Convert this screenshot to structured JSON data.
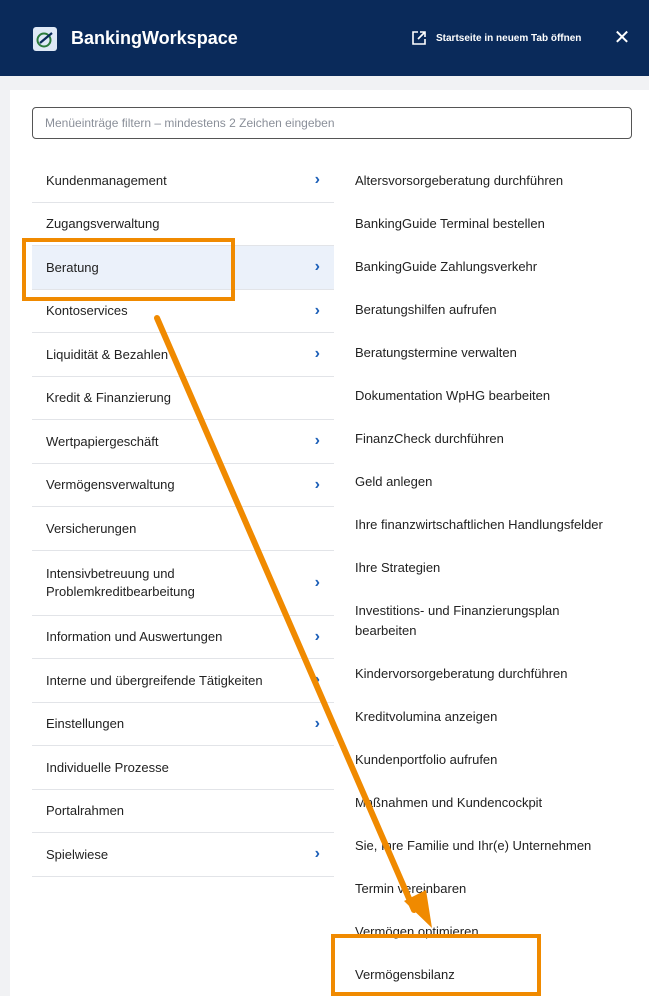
{
  "header": {
    "app_title": "BankingWorkspace",
    "open_tab_label": "Startseite in neuem Tab öffnen",
    "close_label": "✕",
    "colors": {
      "background": "#0a2a5a",
      "text": "#ffffff"
    }
  },
  "search": {
    "placeholder": "Menüeinträge filtern – mindestens 2 Zeichen eingeben",
    "value": ""
  },
  "left_menu": [
    {
      "label": "Kundenmanagement",
      "has_children": true
    },
    {
      "label": "Zugangsverwaltung",
      "has_children": false
    },
    {
      "label": "Beratung",
      "has_children": true,
      "selected": true
    },
    {
      "label": "Kontoservices",
      "has_children": true
    },
    {
      "label": "Liquidität & Bezahlen",
      "has_children": true
    },
    {
      "label": "Kredit & Finanzierung",
      "has_children": false
    },
    {
      "label": "Wertpapiergeschäft",
      "has_children": true
    },
    {
      "label": "Vermögensverwaltung",
      "has_children": true
    },
    {
      "label": "Versicherungen",
      "has_children": false
    },
    {
      "label": "Intensivbetreuung und Problemkreditbearbeitung",
      "has_children": true
    },
    {
      "label": "Information und Auswertungen",
      "has_children": true
    },
    {
      "label": "Interne und übergreifende Tätigkeiten",
      "has_children": true
    },
    {
      "label": "Einstellungen",
      "has_children": true
    },
    {
      "label": "Individuelle Prozesse",
      "has_children": false
    },
    {
      "label": "Portalrahmen",
      "has_children": false
    },
    {
      "label": "Spielwiese",
      "has_children": true
    }
  ],
  "right_menu": [
    "Altersvorsorgeberatung durchführen",
    "BankingGuide Terminal bestellen",
    "BankingGuide Zahlungsverkehr",
    "Beratungshilfen aufrufen",
    "Beratungstermine verwalten",
    "Dokumentation WpHG bearbeiten",
    "FinanzCheck durchführen",
    "Geld anlegen",
    "Ihre finanzwirtschaftlichen Handlungsfelder",
    "Ihre Strategien",
    "Investitions- und Finanzierungsplan bearbeiten",
    "Kindervorsorgeberatung durchführen",
    "Kreditvolumina anzeigen",
    "Kundenportfolio aufrufen",
    "Maßnahmen und Kundencockpit",
    "Sie, Ihre Familie und Ihr(e) Unternehmen",
    "Termin vereinbaren",
    "Vermögen optimieren",
    "Vermögensbilanz"
  ],
  "icons": {
    "logo": "banking-workspace-logo-icon",
    "external": "external-link-icon",
    "close": "close-icon",
    "chevron": "chevron-right-icon"
  },
  "annotation_color": "#f08a00"
}
